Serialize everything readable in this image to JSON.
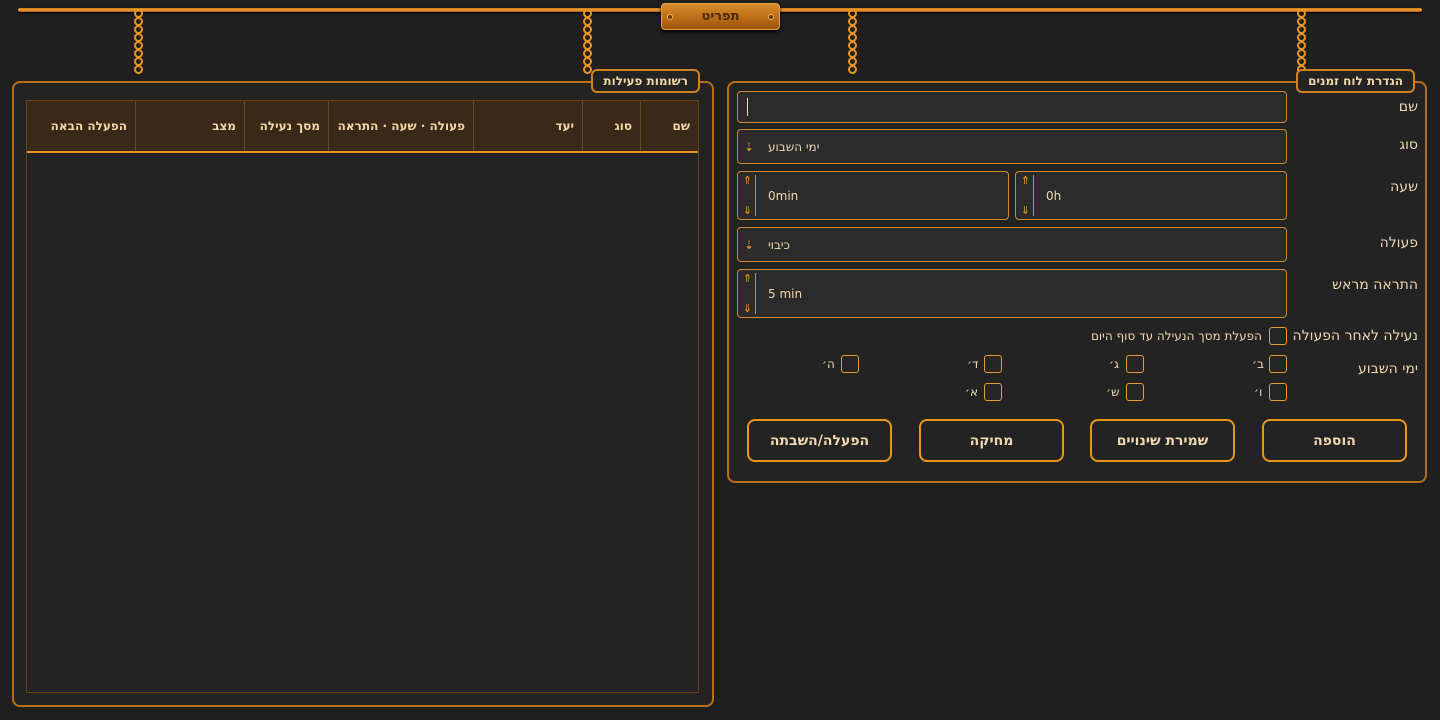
{
  "menu": {
    "label": "תפריט"
  },
  "schedule_panel": {
    "title": "הגדרת לוח זמנים",
    "name": {
      "label": "שם",
      "value": ""
    },
    "type": {
      "label": "סוג",
      "value": "ימי השבוע"
    },
    "time": {
      "label": "שעה",
      "hours": "0h",
      "minutes": "0min"
    },
    "action": {
      "label": "פעולה",
      "value": "כיבוי"
    },
    "advance_warning": {
      "label": "התראה מראש",
      "value": "5 min"
    },
    "lock_after": {
      "label": "נעילה לאחר הפעולה",
      "checkbox_label": "הפעלת מסך הנעילה עד סוף היום"
    },
    "weekdays": {
      "label": "ימי השבוע",
      "days": [
        "ב׳",
        "ג׳",
        "ד׳",
        "ה׳",
        "ו׳",
        "ש׳",
        "א׳"
      ]
    },
    "buttons": {
      "add": "הוספה",
      "save": "שמירת שינויים",
      "delete": "מחיקה",
      "toggle": "הפעלה/השבתה"
    }
  },
  "activity_panel": {
    "title": "רשומות פעילות",
    "columns": [
      "שם",
      "סוג",
      "יעד",
      "פעולה · שעה · התראה",
      "מסך נעילה",
      "מצב",
      "הפעלה הבאה"
    ]
  },
  "colors": {
    "accent": "#e8961e",
    "background": "#1f1f1f",
    "panel_border": "#b86f16",
    "text": "#f0d8b0"
  },
  "icons": [
    "chain-icon",
    "spin-up-icon",
    "spin-down-icon",
    "dropdown-arrow-icon"
  ]
}
